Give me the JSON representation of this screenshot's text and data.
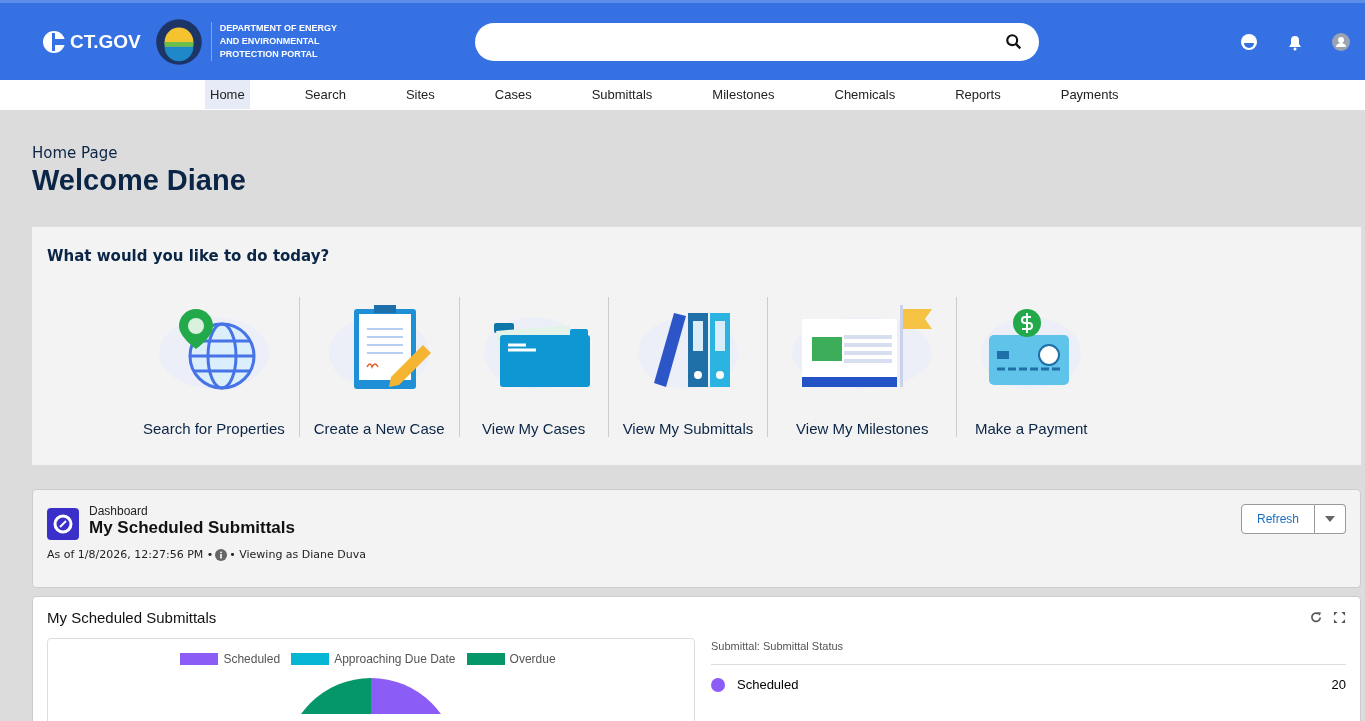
{
  "header": {
    "logo_text": "CT.GOV",
    "agency_lines": [
      "DEPARTMENT OF ENERGY",
      "AND ENVIRONMENTAL",
      "PROTECTION PORTAL"
    ]
  },
  "nav": [
    {
      "label": "Home",
      "selected": true
    },
    {
      "label": "Search",
      "selected": false
    },
    {
      "label": "Sites",
      "selected": false
    },
    {
      "label": "Cases",
      "selected": false
    },
    {
      "label": "Submittals",
      "selected": false
    },
    {
      "label": "Milestones",
      "selected": false
    },
    {
      "label": "Chemicals",
      "selected": false
    },
    {
      "label": "Reports",
      "selected": false
    },
    {
      "label": "Payments",
      "selected": false
    }
  ],
  "page": {
    "breadcrumb": "Home Page",
    "title": "Welcome Diane"
  },
  "actions": {
    "heading": "What would you like to do today?",
    "items": [
      {
        "label": "Search for Properties",
        "kind": "globe"
      },
      {
        "label": "Create a New Case",
        "kind": "clipboard"
      },
      {
        "label": "View My Cases",
        "kind": "folder"
      },
      {
        "label": "View My Submittals",
        "kind": "binders"
      },
      {
        "label": "View My Milestones",
        "kind": "calendar"
      },
      {
        "label": "Make a Payment",
        "kind": "card"
      }
    ]
  },
  "dashboard": {
    "eyebrow": "Dashboard",
    "title": "My Scheduled Submittals",
    "meta_before": "As of 1/8/2026, 12:27:56 PM •",
    "meta_after": "• Viewing as Diane Duva",
    "refresh": "Refresh"
  },
  "report": {
    "title": "My Scheduled Submittals",
    "legend": [
      {
        "label": "Scheduled",
        "color": "#8b5cf6"
      },
      {
        "label": "Approaching Due Date",
        "color": "#06b6d4"
      },
      {
        "label": "Overdue",
        "color": "#059669"
      }
    ],
    "list_heading": "Submittal: Submittal Status",
    "rows": [
      {
        "label": "Scheduled",
        "value": "20",
        "color": "#8b5cf6"
      }
    ]
  }
}
